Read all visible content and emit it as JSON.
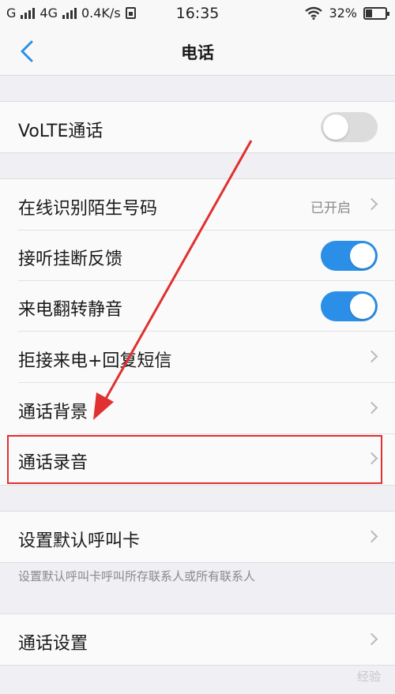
{
  "status_bar": {
    "carrier1": "G",
    "carrier2": "4G",
    "speed": "0.4K/s",
    "time": "16:35",
    "battery": "32%",
    "battery_level": 0.32
  },
  "header": {
    "title": "电话"
  },
  "group1": {
    "volte": {
      "label": "VoLTE通话",
      "enabled": false
    }
  },
  "group2": {
    "items": [
      {
        "label": "在线识别陌生号码",
        "value": "已开启"
      },
      {
        "label": "接听挂断反馈",
        "enabled": true
      },
      {
        "label": "来电翻转静音",
        "enabled": true
      },
      {
        "label": "拒接来电+回复短信"
      },
      {
        "label": "通话背景"
      },
      {
        "label": "通话录音"
      }
    ]
  },
  "group3": {
    "default_card": {
      "label": "设置默认呼叫卡"
    },
    "hint": "设置默认呼叫卡呼叫所存联系人或所有联系人"
  },
  "group4": {
    "call_settings": {
      "label": "通话设置"
    }
  },
  "colors": {
    "accent": "#2b8fe8",
    "highlight": "#e03030"
  },
  "watermark": "经验"
}
